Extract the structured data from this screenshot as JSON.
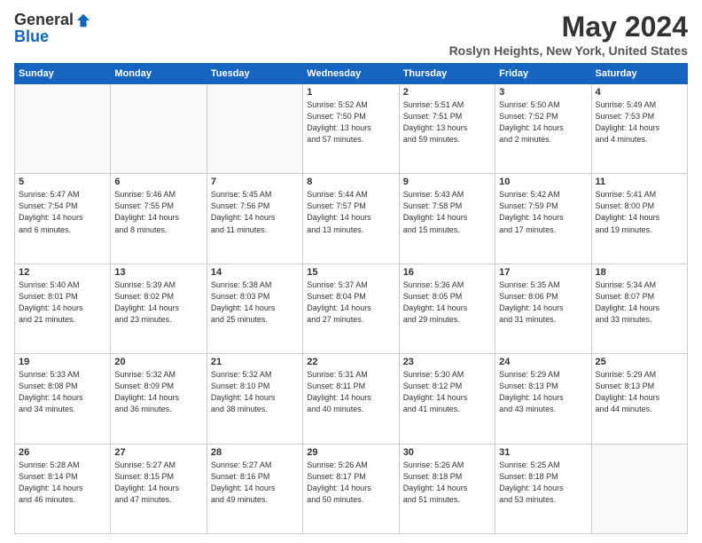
{
  "logo": {
    "general": "General",
    "blue": "Blue"
  },
  "header": {
    "title": "May 2024",
    "subtitle": "Roslyn Heights, New York, United States"
  },
  "weekdays": [
    "Sunday",
    "Monday",
    "Tuesday",
    "Wednesday",
    "Thursday",
    "Friday",
    "Saturday"
  ],
  "weeks": [
    [
      {
        "day": "",
        "info": ""
      },
      {
        "day": "",
        "info": ""
      },
      {
        "day": "",
        "info": ""
      },
      {
        "day": "1",
        "info": "Sunrise: 5:52 AM\nSunset: 7:50 PM\nDaylight: 13 hours\nand 57 minutes."
      },
      {
        "day": "2",
        "info": "Sunrise: 5:51 AM\nSunset: 7:51 PM\nDaylight: 13 hours\nand 59 minutes."
      },
      {
        "day": "3",
        "info": "Sunrise: 5:50 AM\nSunset: 7:52 PM\nDaylight: 14 hours\nand 2 minutes."
      },
      {
        "day": "4",
        "info": "Sunrise: 5:49 AM\nSunset: 7:53 PM\nDaylight: 14 hours\nand 4 minutes."
      }
    ],
    [
      {
        "day": "5",
        "info": "Sunrise: 5:47 AM\nSunset: 7:54 PM\nDaylight: 14 hours\nand 6 minutes."
      },
      {
        "day": "6",
        "info": "Sunrise: 5:46 AM\nSunset: 7:55 PM\nDaylight: 14 hours\nand 8 minutes."
      },
      {
        "day": "7",
        "info": "Sunrise: 5:45 AM\nSunset: 7:56 PM\nDaylight: 14 hours\nand 11 minutes."
      },
      {
        "day": "8",
        "info": "Sunrise: 5:44 AM\nSunset: 7:57 PM\nDaylight: 14 hours\nand 13 minutes."
      },
      {
        "day": "9",
        "info": "Sunrise: 5:43 AM\nSunset: 7:58 PM\nDaylight: 14 hours\nand 15 minutes."
      },
      {
        "day": "10",
        "info": "Sunrise: 5:42 AM\nSunset: 7:59 PM\nDaylight: 14 hours\nand 17 minutes."
      },
      {
        "day": "11",
        "info": "Sunrise: 5:41 AM\nSunset: 8:00 PM\nDaylight: 14 hours\nand 19 minutes."
      }
    ],
    [
      {
        "day": "12",
        "info": "Sunrise: 5:40 AM\nSunset: 8:01 PM\nDaylight: 14 hours\nand 21 minutes."
      },
      {
        "day": "13",
        "info": "Sunrise: 5:39 AM\nSunset: 8:02 PM\nDaylight: 14 hours\nand 23 minutes."
      },
      {
        "day": "14",
        "info": "Sunrise: 5:38 AM\nSunset: 8:03 PM\nDaylight: 14 hours\nand 25 minutes."
      },
      {
        "day": "15",
        "info": "Sunrise: 5:37 AM\nSunset: 8:04 PM\nDaylight: 14 hours\nand 27 minutes."
      },
      {
        "day": "16",
        "info": "Sunrise: 5:36 AM\nSunset: 8:05 PM\nDaylight: 14 hours\nand 29 minutes."
      },
      {
        "day": "17",
        "info": "Sunrise: 5:35 AM\nSunset: 8:06 PM\nDaylight: 14 hours\nand 31 minutes."
      },
      {
        "day": "18",
        "info": "Sunrise: 5:34 AM\nSunset: 8:07 PM\nDaylight: 14 hours\nand 33 minutes."
      }
    ],
    [
      {
        "day": "19",
        "info": "Sunrise: 5:33 AM\nSunset: 8:08 PM\nDaylight: 14 hours\nand 34 minutes."
      },
      {
        "day": "20",
        "info": "Sunrise: 5:32 AM\nSunset: 8:09 PM\nDaylight: 14 hours\nand 36 minutes."
      },
      {
        "day": "21",
        "info": "Sunrise: 5:32 AM\nSunset: 8:10 PM\nDaylight: 14 hours\nand 38 minutes."
      },
      {
        "day": "22",
        "info": "Sunrise: 5:31 AM\nSunset: 8:11 PM\nDaylight: 14 hours\nand 40 minutes."
      },
      {
        "day": "23",
        "info": "Sunrise: 5:30 AM\nSunset: 8:12 PM\nDaylight: 14 hours\nand 41 minutes."
      },
      {
        "day": "24",
        "info": "Sunrise: 5:29 AM\nSunset: 8:13 PM\nDaylight: 14 hours\nand 43 minutes."
      },
      {
        "day": "25",
        "info": "Sunrise: 5:29 AM\nSunset: 8:13 PM\nDaylight: 14 hours\nand 44 minutes."
      }
    ],
    [
      {
        "day": "26",
        "info": "Sunrise: 5:28 AM\nSunset: 8:14 PM\nDaylight: 14 hours\nand 46 minutes."
      },
      {
        "day": "27",
        "info": "Sunrise: 5:27 AM\nSunset: 8:15 PM\nDaylight: 14 hours\nand 47 minutes."
      },
      {
        "day": "28",
        "info": "Sunrise: 5:27 AM\nSunset: 8:16 PM\nDaylight: 14 hours\nand 49 minutes."
      },
      {
        "day": "29",
        "info": "Sunrise: 5:26 AM\nSunset: 8:17 PM\nDaylight: 14 hours\nand 50 minutes."
      },
      {
        "day": "30",
        "info": "Sunrise: 5:26 AM\nSunset: 8:18 PM\nDaylight: 14 hours\nand 51 minutes."
      },
      {
        "day": "31",
        "info": "Sunrise: 5:25 AM\nSunset: 8:18 PM\nDaylight: 14 hours\nand 53 minutes."
      },
      {
        "day": "",
        "info": ""
      }
    ]
  ]
}
